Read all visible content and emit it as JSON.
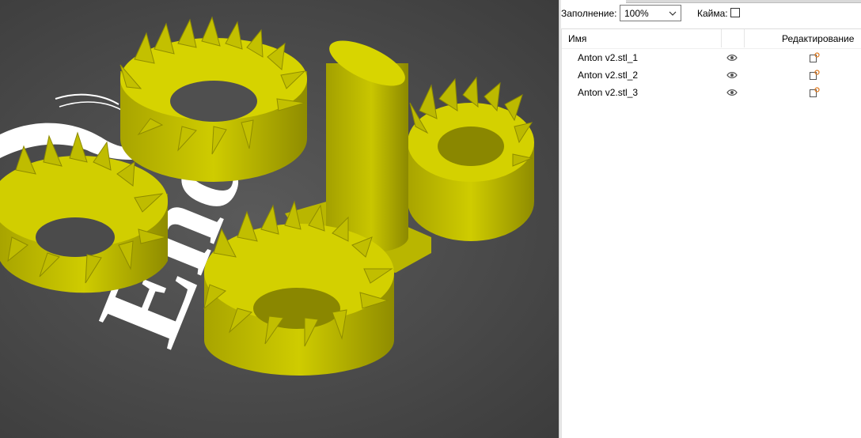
{
  "toolbar": {
    "fill_label": "Заполнение:",
    "fill_value": "100%",
    "border_label": "Кайма:",
    "border_checked": false
  },
  "list": {
    "header_name": "Имя",
    "header_edit": "Редактирование",
    "items": [
      {
        "name": "Anton v2.stl_1"
      },
      {
        "name": "Anton v2.stl_2"
      },
      {
        "name": "Anton v2.stl_3"
      }
    ]
  },
  "viewport": {
    "bed_logo_text": "Ender",
    "model_color": "#c8c800",
    "bed_color": "#4a4a4a"
  },
  "icons": {
    "visibility": "eye-icon",
    "edit": "edit-settings-icon",
    "dropdown": "chevron-down-icon"
  }
}
